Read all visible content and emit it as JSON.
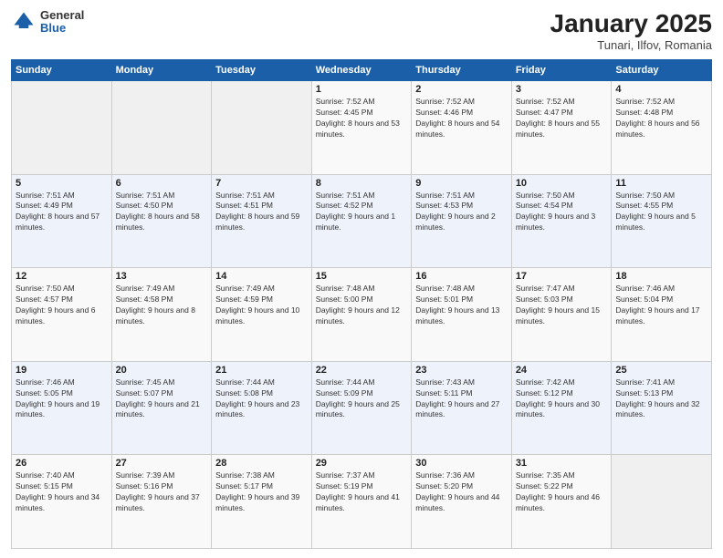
{
  "header": {
    "logo": {
      "general": "General",
      "blue": "Blue"
    },
    "title": "January 2025",
    "subtitle": "Tunari, Ilfov, Romania"
  },
  "weekdays": [
    "Sunday",
    "Monday",
    "Tuesday",
    "Wednesday",
    "Thursday",
    "Friday",
    "Saturday"
  ],
  "weeks": [
    [
      {
        "day": "",
        "info": ""
      },
      {
        "day": "",
        "info": ""
      },
      {
        "day": "",
        "info": ""
      },
      {
        "day": "1",
        "info": "Sunrise: 7:52 AM\nSunset: 4:45 PM\nDaylight: 8 hours and 53 minutes."
      },
      {
        "day": "2",
        "info": "Sunrise: 7:52 AM\nSunset: 4:46 PM\nDaylight: 8 hours and 54 minutes."
      },
      {
        "day": "3",
        "info": "Sunrise: 7:52 AM\nSunset: 4:47 PM\nDaylight: 8 hours and 55 minutes."
      },
      {
        "day": "4",
        "info": "Sunrise: 7:52 AM\nSunset: 4:48 PM\nDaylight: 8 hours and 56 minutes."
      }
    ],
    [
      {
        "day": "5",
        "info": "Sunrise: 7:51 AM\nSunset: 4:49 PM\nDaylight: 8 hours and 57 minutes."
      },
      {
        "day": "6",
        "info": "Sunrise: 7:51 AM\nSunset: 4:50 PM\nDaylight: 8 hours and 58 minutes."
      },
      {
        "day": "7",
        "info": "Sunrise: 7:51 AM\nSunset: 4:51 PM\nDaylight: 8 hours and 59 minutes."
      },
      {
        "day": "8",
        "info": "Sunrise: 7:51 AM\nSunset: 4:52 PM\nDaylight: 9 hours and 1 minute."
      },
      {
        "day": "9",
        "info": "Sunrise: 7:51 AM\nSunset: 4:53 PM\nDaylight: 9 hours and 2 minutes."
      },
      {
        "day": "10",
        "info": "Sunrise: 7:50 AM\nSunset: 4:54 PM\nDaylight: 9 hours and 3 minutes."
      },
      {
        "day": "11",
        "info": "Sunrise: 7:50 AM\nSunset: 4:55 PM\nDaylight: 9 hours and 5 minutes."
      }
    ],
    [
      {
        "day": "12",
        "info": "Sunrise: 7:50 AM\nSunset: 4:57 PM\nDaylight: 9 hours and 6 minutes."
      },
      {
        "day": "13",
        "info": "Sunrise: 7:49 AM\nSunset: 4:58 PM\nDaylight: 9 hours and 8 minutes."
      },
      {
        "day": "14",
        "info": "Sunrise: 7:49 AM\nSunset: 4:59 PM\nDaylight: 9 hours and 10 minutes."
      },
      {
        "day": "15",
        "info": "Sunrise: 7:48 AM\nSunset: 5:00 PM\nDaylight: 9 hours and 12 minutes."
      },
      {
        "day": "16",
        "info": "Sunrise: 7:48 AM\nSunset: 5:01 PM\nDaylight: 9 hours and 13 minutes."
      },
      {
        "day": "17",
        "info": "Sunrise: 7:47 AM\nSunset: 5:03 PM\nDaylight: 9 hours and 15 minutes."
      },
      {
        "day": "18",
        "info": "Sunrise: 7:46 AM\nSunset: 5:04 PM\nDaylight: 9 hours and 17 minutes."
      }
    ],
    [
      {
        "day": "19",
        "info": "Sunrise: 7:46 AM\nSunset: 5:05 PM\nDaylight: 9 hours and 19 minutes."
      },
      {
        "day": "20",
        "info": "Sunrise: 7:45 AM\nSunset: 5:07 PM\nDaylight: 9 hours and 21 minutes."
      },
      {
        "day": "21",
        "info": "Sunrise: 7:44 AM\nSunset: 5:08 PM\nDaylight: 9 hours and 23 minutes."
      },
      {
        "day": "22",
        "info": "Sunrise: 7:44 AM\nSunset: 5:09 PM\nDaylight: 9 hours and 25 minutes."
      },
      {
        "day": "23",
        "info": "Sunrise: 7:43 AM\nSunset: 5:11 PM\nDaylight: 9 hours and 27 minutes."
      },
      {
        "day": "24",
        "info": "Sunrise: 7:42 AM\nSunset: 5:12 PM\nDaylight: 9 hours and 30 minutes."
      },
      {
        "day": "25",
        "info": "Sunrise: 7:41 AM\nSunset: 5:13 PM\nDaylight: 9 hours and 32 minutes."
      }
    ],
    [
      {
        "day": "26",
        "info": "Sunrise: 7:40 AM\nSunset: 5:15 PM\nDaylight: 9 hours and 34 minutes."
      },
      {
        "day": "27",
        "info": "Sunrise: 7:39 AM\nSunset: 5:16 PM\nDaylight: 9 hours and 37 minutes."
      },
      {
        "day": "28",
        "info": "Sunrise: 7:38 AM\nSunset: 5:17 PM\nDaylight: 9 hours and 39 minutes."
      },
      {
        "day": "29",
        "info": "Sunrise: 7:37 AM\nSunset: 5:19 PM\nDaylight: 9 hours and 41 minutes."
      },
      {
        "day": "30",
        "info": "Sunrise: 7:36 AM\nSunset: 5:20 PM\nDaylight: 9 hours and 44 minutes."
      },
      {
        "day": "31",
        "info": "Sunrise: 7:35 AM\nSunset: 5:22 PM\nDaylight: 9 hours and 46 minutes."
      },
      {
        "day": "",
        "info": ""
      }
    ]
  ]
}
